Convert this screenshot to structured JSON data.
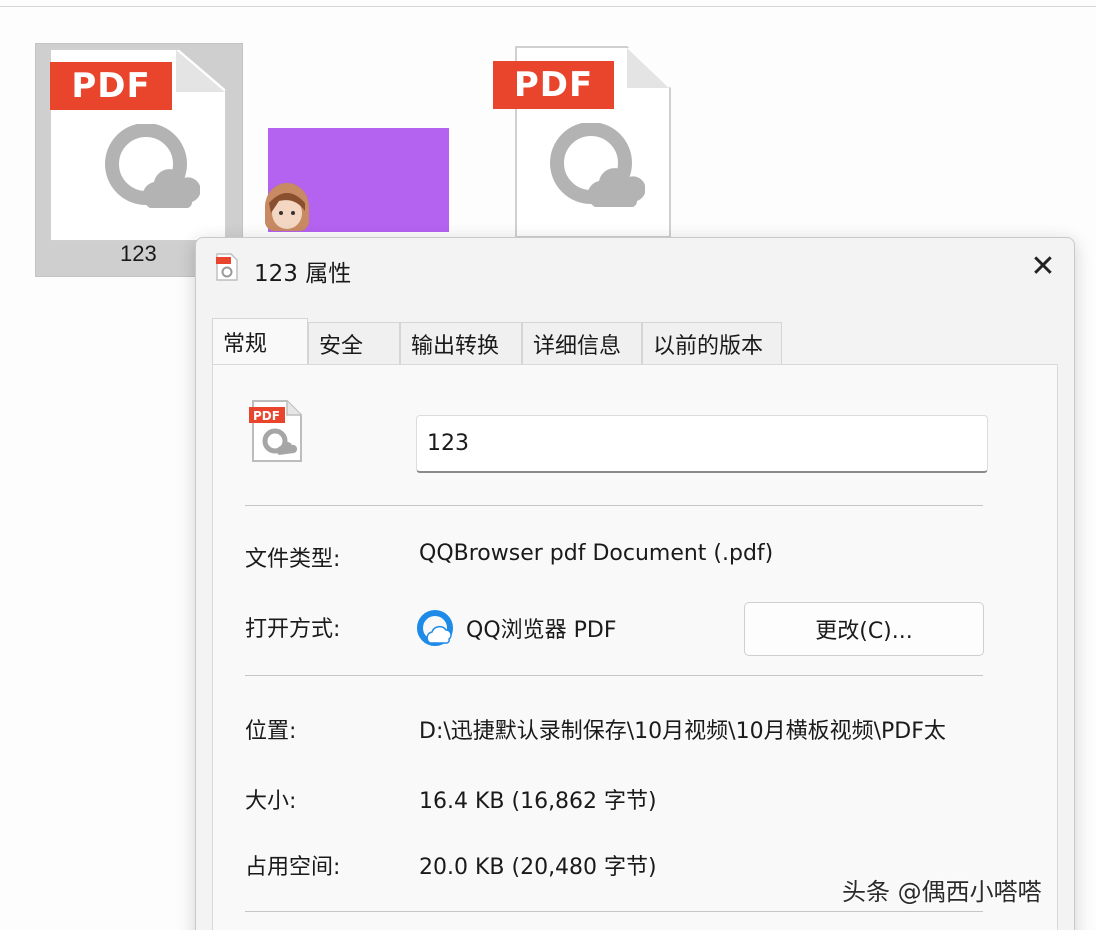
{
  "explorer": {
    "files": [
      {
        "badge": "PDF",
        "label": "123",
        "selected": true
      },
      {
        "badge": "",
        "label": ""
      },
      {
        "badge": "PDF",
        "label": ""
      }
    ]
  },
  "dialog": {
    "title": "123 属性",
    "tabs": [
      {
        "label": "常规",
        "active": true
      },
      {
        "label": "安全"
      },
      {
        "label": "输出转换"
      },
      {
        "label": "详细信息"
      },
      {
        "label": "以前的版本"
      }
    ],
    "icon_badge": "PDF",
    "file_name": "123",
    "fields": {
      "file_type_label": "文件类型:",
      "file_type_value": "QQBrowser pdf Document (.pdf)",
      "open_with_label": "打开方式:",
      "open_with_value": "QQ浏览器 PDF",
      "change_button": "更改(C)...",
      "location_label": "位置:",
      "location_value": "D:\\迅捷默认录制保存\\10月视频\\10月横板视频\\PDF太",
      "size_label": "大小:",
      "size_value": "16.4 KB (16,862 字节)",
      "disk_size_label": "占用空间:",
      "disk_size_value": "20.0 KB (20,480 字节)"
    }
  },
  "watermark": "头条 @偶西小嗒嗒",
  "colors": {
    "pdf_badge": "#e8452c",
    "thumbnail_purple": "#b462f0",
    "qq_blue": "#1e8be8"
  },
  "icons": [
    "pdf-file-icon",
    "qq-browser-logo",
    "close-icon"
  ]
}
